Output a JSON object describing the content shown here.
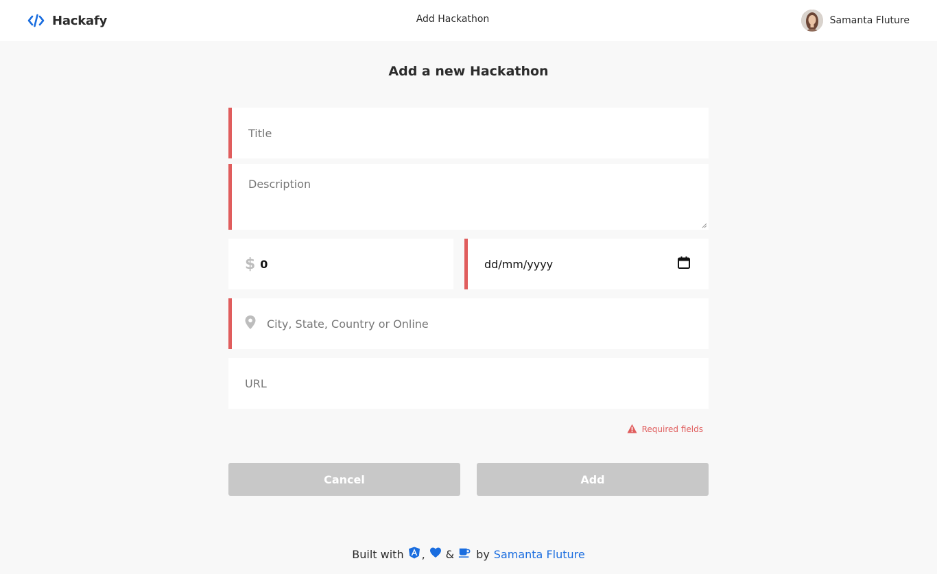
{
  "app": {
    "name": "Hackafy",
    "nav_title": "Add Hackathon"
  },
  "user": {
    "name": "Samanta Fluture"
  },
  "page": {
    "title": "Add a new Hackathon"
  },
  "form": {
    "title_placeholder": "Title",
    "description_placeholder": "Description",
    "prize_symbol": "$",
    "prize_value": "0",
    "date_placeholder": "dd/mm/yyyy",
    "location_placeholder": "City, State, Country or Online",
    "url_placeholder": "URL",
    "required_note": "Required fields"
  },
  "buttons": {
    "cancel": "Cancel",
    "add": "Add"
  },
  "footer": {
    "built_with": "Built with",
    "comma": ",",
    "ampersand": "&",
    "by": "by",
    "author": "Samanta Fluture"
  },
  "colors": {
    "accent": "#1a6ddf",
    "required": "#e05d5d",
    "button_disabled": "#c8c8c8",
    "background": "#f8f8f8"
  },
  "icons": [
    "code-icon",
    "map-pin-icon",
    "calendar-icon",
    "warning-icon",
    "angular-icon",
    "heart-icon",
    "coffee-icon"
  ]
}
